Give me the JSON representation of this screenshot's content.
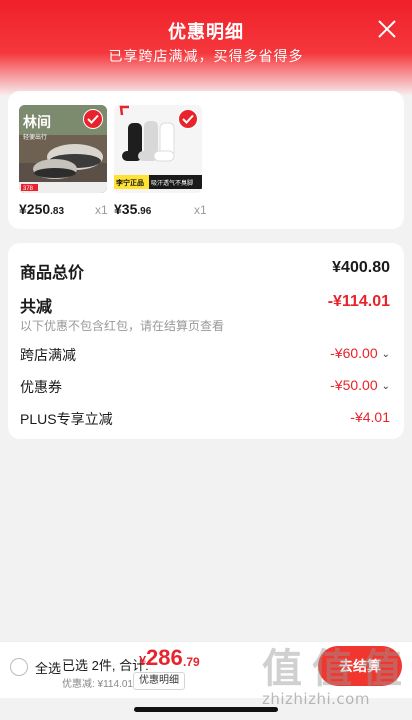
{
  "header": {
    "title": "优惠明细",
    "subtitle": "已享跨店满减，买得多省得多"
  },
  "products": [
    {
      "price_int": "¥250",
      "price_dec": ".83",
      "qty": "x1",
      "thumb_text": "林间",
      "thumb_sub": "轻便出行",
      "thumb_tag": "378"
    },
    {
      "price_int": "¥35",
      "price_dec": ".96",
      "qty": "x1",
      "tag_brand": "李宁正品",
      "tag_feature": "吸汗透气不臭脚"
    }
  ],
  "summary": {
    "goods_total_label": "商品总价",
    "goods_total_value": "¥400.80",
    "total_discount_label": "共减",
    "total_discount_value": "-¥114.01",
    "note": "以下优惠不包含红包，请在结算页查看",
    "items": [
      {
        "label": "跨店满减",
        "value": "-¥60.00",
        "expandable": true
      },
      {
        "label": "优惠券",
        "value": "-¥50.00",
        "expandable": true
      },
      {
        "label": "PLUS专享立减",
        "value": "-¥4.01",
        "expandable": false
      }
    ]
  },
  "bottom_bar": {
    "select_all": "全选",
    "selected_text": "已选 2件, 合计:",
    "total_symbol": "¥",
    "total_int": "286",
    "total_dec": ".79",
    "discount_line": "优惠减: ¥114.01",
    "detail_tag": "优惠明细",
    "checkout_label": "去结算"
  },
  "watermark": {
    "logo": "值",
    "url": "zhizhizhi.com"
  },
  "colors": {
    "accent_red": "#e8232b",
    "header_red": "#f0202a"
  }
}
